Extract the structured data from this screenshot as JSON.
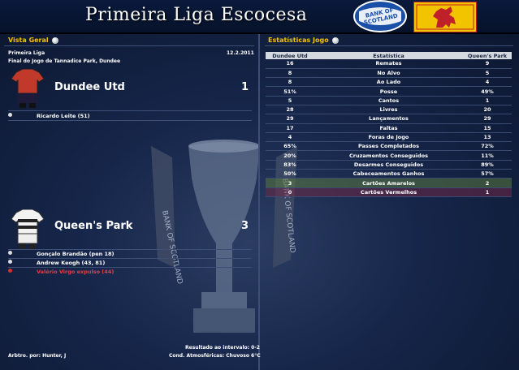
{
  "banner": {
    "title": "Primeira Liga Escocesa",
    "sponsor_logo": "BANK OF SCOTLAND"
  },
  "overview": {
    "section_title": "Vista Geral",
    "competition": "Primeira Liga",
    "date": "12.2.2011",
    "venue": "Final do Jogo de Tannadice Park, Dundee",
    "home": {
      "name": "Dundee Utd",
      "score": "1",
      "kit_colors": [
        "#c0392b",
        "#1c1c3a"
      ],
      "events": [
        {
          "text": "Ricardo Leite (51)",
          "type": "goal"
        }
      ]
    },
    "away": {
      "name": "Queen's Park",
      "score": "3",
      "kit_colors": [
        "#f2f2f2",
        "#222222"
      ],
      "events": [
        {
          "text": "Gonçalo Brandão (pen 18)",
          "type": "goal"
        },
        {
          "text": "Andrew Keogh (43, 81)",
          "type": "goal"
        },
        {
          "text": "Valério Virgo expulso (44)",
          "type": "red-card"
        }
      ]
    },
    "referee": "Arbtro. por: Hunter, J",
    "half_time": "Resultado ao intervalo: 0-2",
    "weather": "Cond. Atmosféricas: Chuvoso 6°C"
  },
  "stats": {
    "section_title": "Estatísticas Jogo",
    "headers": [
      "Dundee Utd",
      "Estatística",
      "Queen's Park"
    ],
    "rows": [
      [
        "16",
        "Remates",
        "9"
      ],
      [
        "8",
        "No Alvo",
        "5"
      ],
      [
        "8",
        "Ao Lado",
        "4"
      ],
      [
        "51%",
        "Posse",
        "49%"
      ],
      [
        "5",
        "Cantos",
        "1"
      ],
      [
        "28",
        "Livres",
        "20"
      ],
      [
        "29",
        "Lançamentos",
        "29"
      ],
      [
        "17",
        "Faltas",
        "15"
      ],
      [
        "4",
        "Foras de Jogo",
        "13"
      ],
      [
        "65%",
        "Passes Completados",
        "72%"
      ],
      [
        "20%",
        "Cruzamentos Conseguidos",
        "11%"
      ],
      [
        "83%",
        "Desarmes Conseguidos",
        "89%"
      ],
      [
        "50%",
        "Cabeceamentos Ganhos",
        "57%"
      ],
      [
        "3",
        "Cartões Amarelos",
        "2"
      ],
      [
        "0",
        "Cartões Vermelhos",
        "1"
      ]
    ]
  }
}
